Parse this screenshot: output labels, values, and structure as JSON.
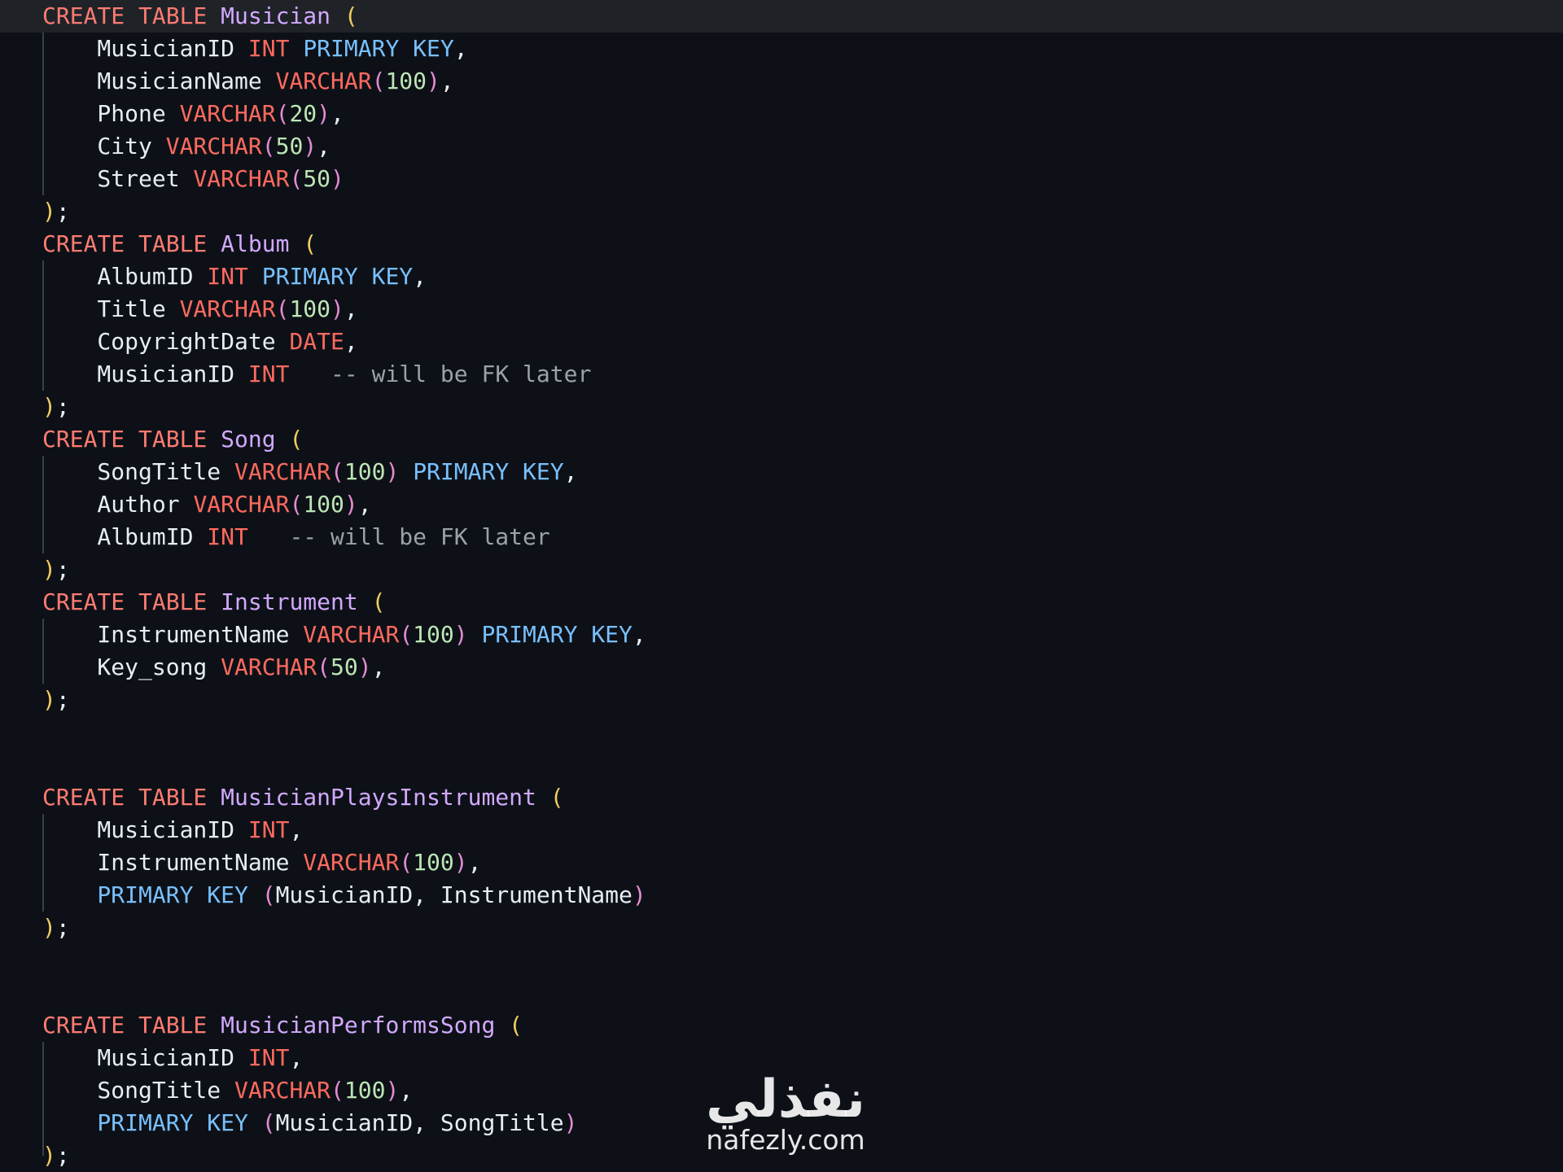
{
  "editor": {
    "lines": [
      [
        {
          "t": "CREATE TABLE ",
          "c": "kw"
        },
        {
          "t": "Musician ",
          "c": "tn"
        },
        {
          "t": "(",
          "c": "p1"
        }
      ],
      [
        {
          "t": "    MusicianID ",
          "c": "tx"
        },
        {
          "t": "INT ",
          "c": "ty"
        },
        {
          "t": "PRIMARY KEY",
          "c": "pk"
        },
        {
          "t": ",",
          "c": "tx"
        }
      ],
      [
        {
          "t": "    MusicianName ",
          "c": "tx"
        },
        {
          "t": "VARCHAR",
          "c": "ty"
        },
        {
          "t": "(",
          "c": "p2"
        },
        {
          "t": "100",
          "c": "num"
        },
        {
          "t": ")",
          "c": "p2"
        },
        {
          "t": ",",
          "c": "tx"
        }
      ],
      [
        {
          "t": "    Phone ",
          "c": "tx"
        },
        {
          "t": "VARCHAR",
          "c": "ty"
        },
        {
          "t": "(",
          "c": "p2"
        },
        {
          "t": "20",
          "c": "num"
        },
        {
          "t": ")",
          "c": "p2"
        },
        {
          "t": ",",
          "c": "tx"
        }
      ],
      [
        {
          "t": "    City ",
          "c": "tx"
        },
        {
          "t": "VARCHAR",
          "c": "ty"
        },
        {
          "t": "(",
          "c": "p2"
        },
        {
          "t": "50",
          "c": "num"
        },
        {
          "t": ")",
          "c": "p2"
        },
        {
          "t": ",",
          "c": "tx"
        }
      ],
      [
        {
          "t": "    Street ",
          "c": "tx"
        },
        {
          "t": "VARCHAR",
          "c": "ty"
        },
        {
          "t": "(",
          "c": "p2"
        },
        {
          "t": "50",
          "c": "num"
        },
        {
          "t": ")",
          "c": "p2"
        }
      ],
      [
        {
          "t": ")",
          "c": "p1"
        },
        {
          "t": ";",
          "c": "tx"
        }
      ],
      [
        {
          "t": "CREATE TABLE ",
          "c": "kw"
        },
        {
          "t": "Album ",
          "c": "tn"
        },
        {
          "t": "(",
          "c": "p1"
        }
      ],
      [
        {
          "t": "    AlbumID ",
          "c": "tx"
        },
        {
          "t": "INT ",
          "c": "ty"
        },
        {
          "t": "PRIMARY KEY",
          "c": "pk"
        },
        {
          "t": ",",
          "c": "tx"
        }
      ],
      [
        {
          "t": "    Title ",
          "c": "tx"
        },
        {
          "t": "VARCHAR",
          "c": "ty"
        },
        {
          "t": "(",
          "c": "p2"
        },
        {
          "t": "100",
          "c": "num"
        },
        {
          "t": ")",
          "c": "p2"
        },
        {
          "t": ",",
          "c": "tx"
        }
      ],
      [
        {
          "t": "    CopyrightDate ",
          "c": "tx"
        },
        {
          "t": "DATE",
          "c": "ty"
        },
        {
          "t": ",",
          "c": "tx"
        }
      ],
      [
        {
          "t": "    MusicianID ",
          "c": "tx"
        },
        {
          "t": "INT",
          "c": "ty"
        },
        {
          "t": "   -- will be FK later",
          "c": "cm"
        }
      ],
      [
        {
          "t": ")",
          "c": "p1"
        },
        {
          "t": ";",
          "c": "tx"
        }
      ],
      [
        {
          "t": "CREATE TABLE ",
          "c": "kw"
        },
        {
          "t": "Song ",
          "c": "tn"
        },
        {
          "t": "(",
          "c": "p1"
        }
      ],
      [
        {
          "t": "    SongTitle ",
          "c": "tx"
        },
        {
          "t": "VARCHAR",
          "c": "ty"
        },
        {
          "t": "(",
          "c": "p2"
        },
        {
          "t": "100",
          "c": "num"
        },
        {
          "t": ") ",
          "c": "p2"
        },
        {
          "t": "PRIMARY KEY",
          "c": "pk"
        },
        {
          "t": ",",
          "c": "tx"
        }
      ],
      [
        {
          "t": "    Author ",
          "c": "tx"
        },
        {
          "t": "VARCHAR",
          "c": "ty"
        },
        {
          "t": "(",
          "c": "p2"
        },
        {
          "t": "100",
          "c": "num"
        },
        {
          "t": ")",
          "c": "p2"
        },
        {
          "t": ",",
          "c": "tx"
        }
      ],
      [
        {
          "t": "    AlbumID ",
          "c": "tx"
        },
        {
          "t": "INT",
          "c": "ty"
        },
        {
          "t": "   -- will be FK later",
          "c": "cm"
        }
      ],
      [
        {
          "t": ")",
          "c": "p1"
        },
        {
          "t": ";",
          "c": "tx"
        }
      ],
      [
        {
          "t": "CREATE TABLE ",
          "c": "kw"
        },
        {
          "t": "Instrument ",
          "c": "tn"
        },
        {
          "t": "(",
          "c": "p1"
        }
      ],
      [
        {
          "t": "    InstrumentName ",
          "c": "tx"
        },
        {
          "t": "VARCHAR",
          "c": "ty"
        },
        {
          "t": "(",
          "c": "p2"
        },
        {
          "t": "100",
          "c": "num"
        },
        {
          "t": ") ",
          "c": "p2"
        },
        {
          "t": "PRIMARY KEY",
          "c": "pk"
        },
        {
          "t": ",",
          "c": "tx"
        }
      ],
      [
        {
          "t": "    Key_song ",
          "c": "tx"
        },
        {
          "t": "VARCHAR",
          "c": "ty"
        },
        {
          "t": "(",
          "c": "p2"
        },
        {
          "t": "50",
          "c": "num"
        },
        {
          "t": ")",
          "c": "p2"
        },
        {
          "t": ",",
          "c": "tx"
        }
      ],
      [
        {
          "t": ")",
          "c": "p1"
        },
        {
          "t": ";",
          "c": "tx"
        }
      ],
      [],
      [],
      [
        {
          "t": "CREATE TABLE ",
          "c": "kw"
        },
        {
          "t": "MusicianPlaysInstrument ",
          "c": "tn"
        },
        {
          "t": "(",
          "c": "p1"
        }
      ],
      [
        {
          "t": "    MusicianID ",
          "c": "tx"
        },
        {
          "t": "INT",
          "c": "ty"
        },
        {
          "t": ",",
          "c": "tx"
        }
      ],
      [
        {
          "t": "    InstrumentName ",
          "c": "tx"
        },
        {
          "t": "VARCHAR",
          "c": "ty"
        },
        {
          "t": "(",
          "c": "p2"
        },
        {
          "t": "100",
          "c": "num"
        },
        {
          "t": ")",
          "c": "p2"
        },
        {
          "t": ",",
          "c": "tx"
        }
      ],
      [
        {
          "t": "    PRIMARY KEY ",
          "c": "pk"
        },
        {
          "t": "(",
          "c": "p2"
        },
        {
          "t": "MusicianID, InstrumentName",
          "c": "tx"
        },
        {
          "t": ")",
          "c": "p2"
        }
      ],
      [
        {
          "t": ")",
          "c": "p1"
        },
        {
          "t": ";",
          "c": "tx"
        }
      ],
      [],
      [],
      [
        {
          "t": "CREATE TABLE ",
          "c": "kw"
        },
        {
          "t": "MusicianPerformsSong ",
          "c": "tn"
        },
        {
          "t": "(",
          "c": "p1"
        }
      ],
      [
        {
          "t": "    MusicianID ",
          "c": "tx"
        },
        {
          "t": "INT",
          "c": "ty"
        },
        {
          "t": ",",
          "c": "tx"
        }
      ],
      [
        {
          "t": "    SongTitle ",
          "c": "tx"
        },
        {
          "t": "VARCHAR",
          "c": "ty"
        },
        {
          "t": "(",
          "c": "p2"
        },
        {
          "t": "100",
          "c": "num"
        },
        {
          "t": ")",
          "c": "p2"
        },
        {
          "t": ",",
          "c": "tx"
        }
      ],
      [
        {
          "t": "    PRIMARY KEY ",
          "c": "pk"
        },
        {
          "t": "(",
          "c": "p2"
        },
        {
          "t": "MusicianID, SongTitle",
          "c": "tx"
        },
        {
          "t": ")",
          "c": "p2"
        }
      ],
      [
        {
          "t": ")",
          "c": "p1"
        },
        {
          "t": ";",
          "c": "tx"
        }
      ]
    ],
    "current_line": 1
  },
  "colors": {
    "background": "#0d1117",
    "keyword": "#ff7b72",
    "type": "#ff6a5f",
    "primary_key": "#79c0ff",
    "table_name": "#d2a8ff",
    "number": "#bde6b5",
    "paren_outer": "#f2cc60",
    "paren_inner": "#e38bd2",
    "text": "#e6edf3",
    "comment": "#9aa1a9"
  },
  "watermark": {
    "arabic": "نفذلي",
    "latin": "nafezly.com"
  }
}
